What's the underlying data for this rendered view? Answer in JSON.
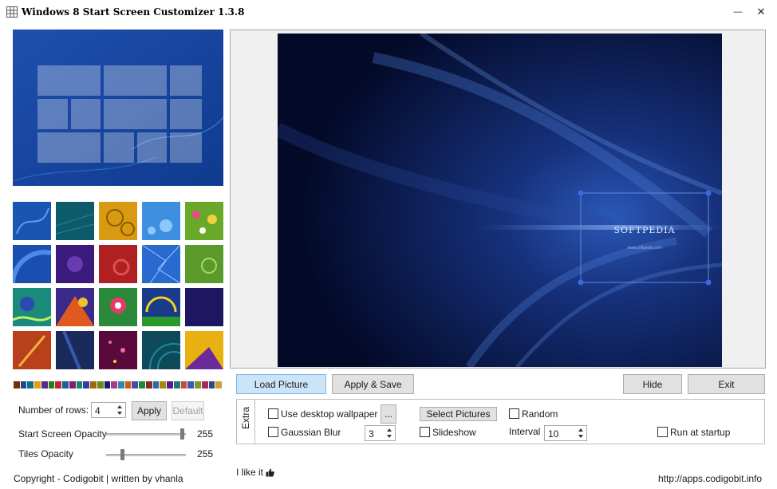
{
  "window": {
    "title": "Windows 8 Start Screen Customizer 1.3.8",
    "minimize_glyph": "—",
    "close_glyph": "✕"
  },
  "settings": {
    "rows_label": "Number of rows:",
    "rows_value": "4",
    "apply_label": "Apply",
    "default_label": "Default",
    "start_opacity_label": "Start Screen Opacity",
    "start_opacity_value": "255",
    "tiles_opacity_label": "Tiles Opacity",
    "tiles_opacity_value": "255"
  },
  "toolbar": {
    "load_picture": "Load Picture",
    "apply_save": "Apply & Save",
    "hide": "Hide",
    "exit": "Exit"
  },
  "extra": {
    "legend": "Extra",
    "use_desktop_wallpaper": "Use desktop wallpaper",
    "browse": "...",
    "select_pictures": "Select Pictures",
    "random": "Random",
    "gaussian_blur": "Gaussian Blur",
    "blur_value": "3",
    "slideshow": "Slideshow",
    "interval_label": "Interval",
    "interval_value": "10",
    "run_at_startup": "Run at startup"
  },
  "wallpaper": {
    "brand": "SOFTPEDIA",
    "brand_url": "www.softpedia.com"
  },
  "footer": {
    "copyright": "Copyright - Codigobit | written by vhanla",
    "like": "I like it",
    "url": "http://apps.codigobit.info"
  },
  "colors": {
    "swatches": [
      "#7a2b0e",
      "#1b4d8c",
      "#0d6e8a",
      "#e0a010",
      "#5a2a8a",
      "#2a7a2a",
      "#c02828",
      "#1a5e9e",
      "#8a1a6a",
      "#0e8a6e",
      "#3a3aa0",
      "#9a6a10",
      "#6a8a1a",
      "#1a1a7a",
      "#aa3a8a",
      "#2a8aaa",
      "#d05a10",
      "#4a4aa8",
      "#188a3a",
      "#8a2a2a",
      "#2a6aaa",
      "#a08a10",
      "#5a1a8a",
      "#1a7a7a",
      "#c84a3a",
      "#3a5ab0",
      "#7a9a2a",
      "#aa2a5a",
      "#2a4a8a",
      "#d0a030"
    ]
  }
}
